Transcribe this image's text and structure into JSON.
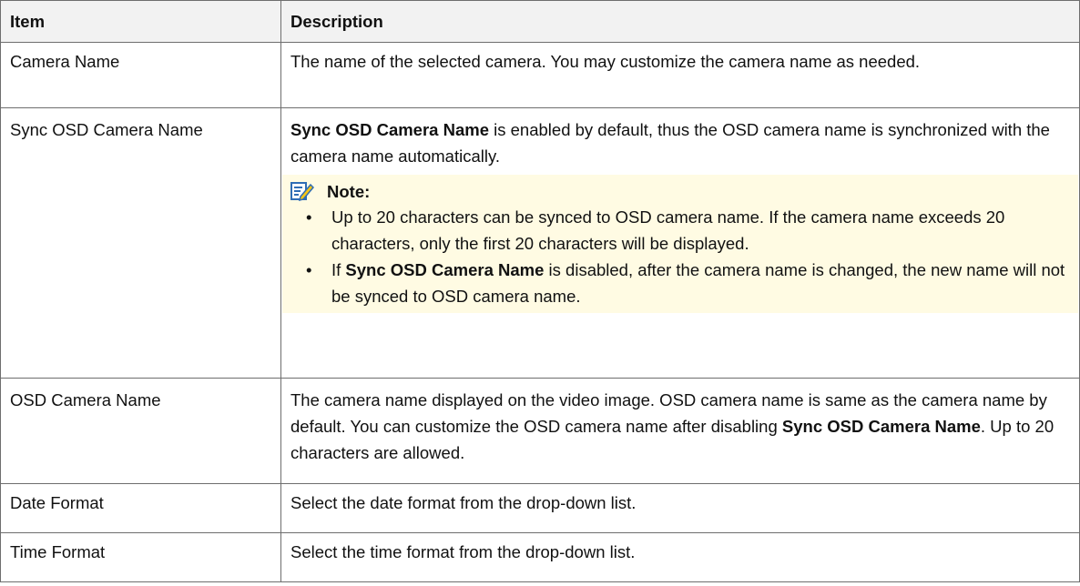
{
  "headers": {
    "item": "Item",
    "description": "Description"
  },
  "rows": {
    "camera_name": {
      "item": "Camera Name",
      "description": "The name of the selected camera. You may customize the camera name as needed."
    },
    "sync_osd": {
      "item": "Sync OSD Camera Name",
      "desc_bold": "Sync OSD Camera Name",
      "desc_rest": " is enabled by default, thus the OSD camera name is synchronized with the camera name automatically.",
      "note_label": "Note:",
      "note_icon": "note-pencil-icon",
      "bullet_1": "Up to 20 characters can be synced to OSD camera name. If the camera name exceeds 20 characters, only the first 20 characters will be displayed.",
      "bullet_2_pre": "If ",
      "bullet_2_bold": "Sync OSD Camera Name",
      "bullet_2_post": " is disabled, after the camera name is changed, the new name will not be synced to OSD camera name."
    },
    "osd_camera_name": {
      "item": "OSD Camera Name",
      "desc_pre": "The camera name displayed on the video image. OSD camera name is same as the camera name by default. You can customize the OSD camera name after disabling ",
      "desc_bold": "Sync OSD Camera Name",
      "desc_post": ". Up to 20 characters are allowed."
    },
    "date_format": {
      "item": "Date Format",
      "description": "Select the date format from the drop-down list."
    },
    "time_format": {
      "item": "Time Format",
      "description": "Select the time format from the drop-down list."
    }
  },
  "colors": {
    "header_bg": "#f2f2f2",
    "note_bg": "#fffbe3",
    "note_icon_accent": "#2f6db5",
    "border": "#6e6e6e"
  }
}
